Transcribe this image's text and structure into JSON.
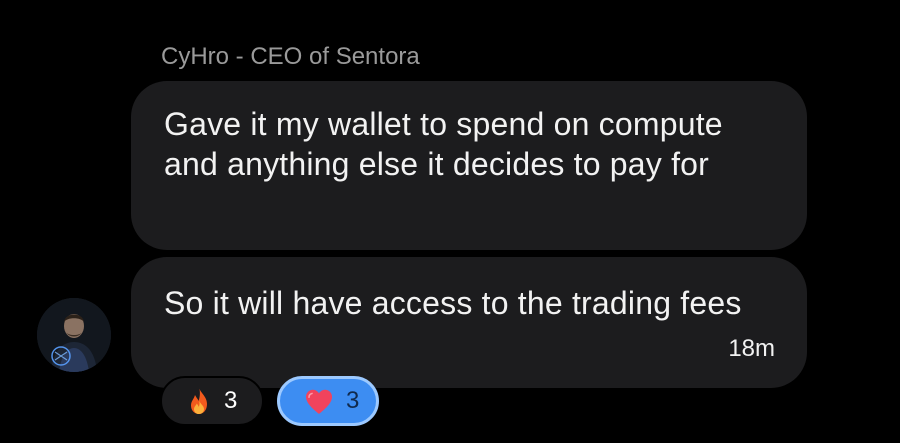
{
  "message_group": {
    "sender_name": "CyHro - CEO of Sentora",
    "messages": [
      {
        "text": "Gave it my wallet to spend on compute and anything else it decides to pay for"
      },
      {
        "text": "So it will have access to the trading fees",
        "timestamp": "18m"
      }
    ],
    "reactions": [
      {
        "icon": "fire-icon",
        "count": "3"
      },
      {
        "icon": "heart-icon",
        "count": "3",
        "selected": true
      }
    ]
  },
  "colors": {
    "background": "#000000",
    "bubble": "#1c1c1e",
    "sender_text": "#9a9a9a",
    "message_text": "#f2f2f2",
    "selected_reaction": "#3d8df2",
    "selected_reaction_border": "#9cc9ff"
  }
}
